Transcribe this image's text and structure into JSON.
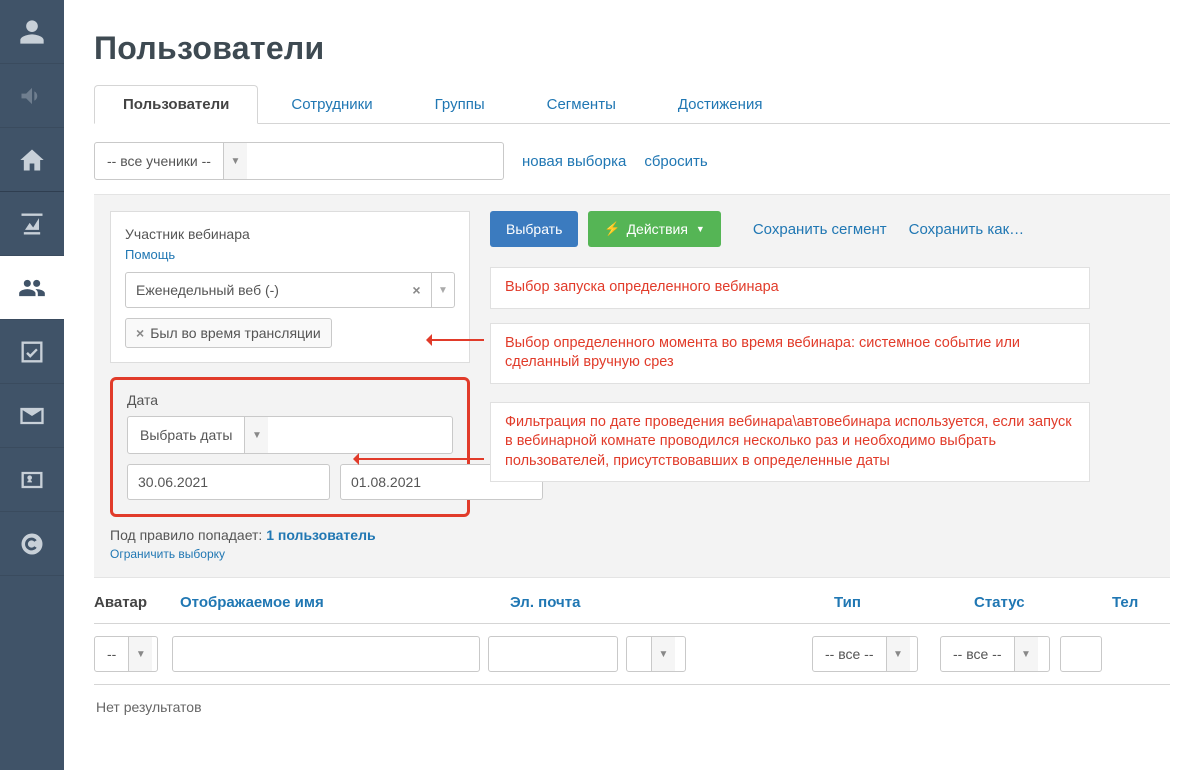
{
  "page": {
    "title": "Пользователи"
  },
  "sidebar": {
    "items": [
      {
        "name": "user-icon"
      },
      {
        "name": "announce-icon"
      },
      {
        "name": "home-icon"
      },
      {
        "name": "chart-icon"
      },
      {
        "name": "users-icon",
        "active": true
      },
      {
        "name": "checkbox-icon"
      },
      {
        "name": "mail-icon"
      },
      {
        "name": "config-card-icon"
      },
      {
        "name": "c-logo-icon"
      }
    ]
  },
  "tabs": [
    {
      "label": "Пользователи",
      "active": true
    },
    {
      "label": "Сотрудники"
    },
    {
      "label": "Группы"
    },
    {
      "label": "Сегменты"
    },
    {
      "label": "Достижения"
    }
  ],
  "filterbar": {
    "scope_value": "-- все ученики --",
    "new_selection": "новая выборка",
    "reset": "сбросить"
  },
  "filterbox": {
    "label": "Участник вебинара",
    "help": "Помощь",
    "webinar_value": "Еженедельный веб (-)",
    "chip_text": "Был во время трансляции"
  },
  "datebox": {
    "label": "Дата",
    "select_value": "Выбрать даты",
    "from": "30.06.2021",
    "to": "01.08.2021"
  },
  "belowbox": {
    "prefix": "Под правило попадает: ",
    "count_link": "1 пользователь",
    "limit": "Ограничить выборку"
  },
  "actions": {
    "select": "Выбрать",
    "actions": "Действия",
    "save_segment": "Сохранить сегмент",
    "save_as": "Сохранить как…"
  },
  "annotations": {
    "a1": "Выбор запуска определенного вебинара",
    "a2": "Выбор определенного момента во время вебинара: системное событие или сделанный вручную срез",
    "a3": "Фильтрация по дате проведения вебинара\\автовебинара используется, если запуск в вебинарной комнате проводился несколько раз и необходимо выбрать пользователей, присутствовавших в определенные даты"
  },
  "table": {
    "headers": {
      "avatar": "Аватар",
      "name": "Отображаемое имя",
      "email": "Эл. почта",
      "type": "Тип",
      "status": "Статус",
      "tel": "Тел"
    },
    "filter_values": {
      "avatar": "--",
      "type": "-- все --",
      "status": "-- все --"
    },
    "empty": "Нет результатов"
  }
}
